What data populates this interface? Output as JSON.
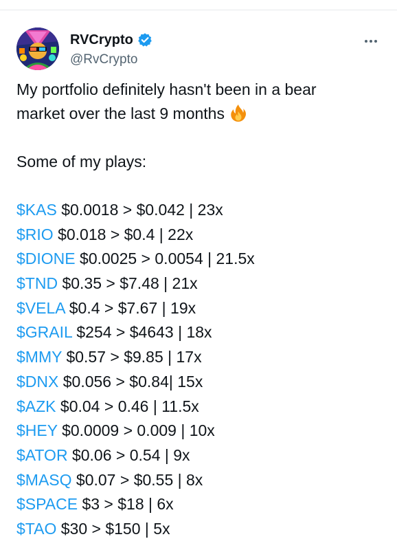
{
  "author": {
    "display_name": "RVCrypto",
    "handle": "@RvCrypto",
    "verified": true
  },
  "tweet": {
    "intro_line1": "My portfolio definitely hasn't been in a bear",
    "intro_line2": "market over the last 9 months",
    "emoji": "fire-icon",
    "plays_heading": "Some of my plays:",
    "plays": [
      {
        "ticker": "$KAS",
        "detail": "$0.0018 > $0.042 | 23x"
      },
      {
        "ticker": "$RIO",
        "detail": "$0.018 > $0.4 | 22x"
      },
      {
        "ticker": "$DIONE",
        "detail": "$0.0025 > 0.0054 | 21.5x"
      },
      {
        "ticker": "$TND",
        "detail": "$0.35 > $7.48 | 21x"
      },
      {
        "ticker": "$VELA",
        "detail": "$0.4 > $7.67 | 19x"
      },
      {
        "ticker": "$GRAIL",
        "detail": "$254 > $4643 | 18x"
      },
      {
        "ticker": "$MMY",
        "detail": "$0.57 > $9.85 | 17x"
      },
      {
        "ticker": "$DNX",
        "detail": "$0.056 > $0.84| 15x"
      },
      {
        "ticker": "$AZK",
        "detail": "$0.04 > 0.46 | 11.5x"
      },
      {
        "ticker": "$HEY",
        "detail": "$0.0009 > 0.009 | 10x"
      },
      {
        "ticker": "$ATOR",
        "detail": "$0.06 > 0.54 | 9x"
      },
      {
        "ticker": "$MASQ",
        "detail": "$0.07 > $0.55 | 8x"
      },
      {
        "ticker": "$SPACE",
        "detail": "$3 > $18 | 6x"
      },
      {
        "ticker": "$TAO",
        "detail": "$30 > $150 | 5x"
      }
    ]
  },
  "colors": {
    "cashtag": "#1d9bf0",
    "text": "#0f1419",
    "secondary": "#536471",
    "verified": "#1d9bf0"
  }
}
